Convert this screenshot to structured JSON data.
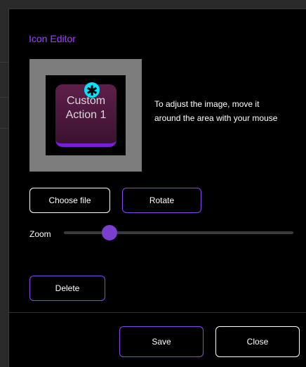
{
  "dialog": {
    "title": "Icon Editor",
    "accent_color": "#a040ff",
    "button_border_color": "#8a44f0"
  },
  "preview": {
    "icon_label": "Custom\nAction 1",
    "badge_symbol": "✱",
    "badge_color": "#00e5ff",
    "tile_color": "#5e1f4a"
  },
  "hint_text": "To adjust the image, move it around the area with your mouse",
  "buttons": {
    "choose_file": "Choose file",
    "rotate": "Rotate",
    "delete": "Delete",
    "save": "Save",
    "close": "Close"
  },
  "zoom": {
    "label": "Zoom",
    "value_fraction": 0.2
  }
}
